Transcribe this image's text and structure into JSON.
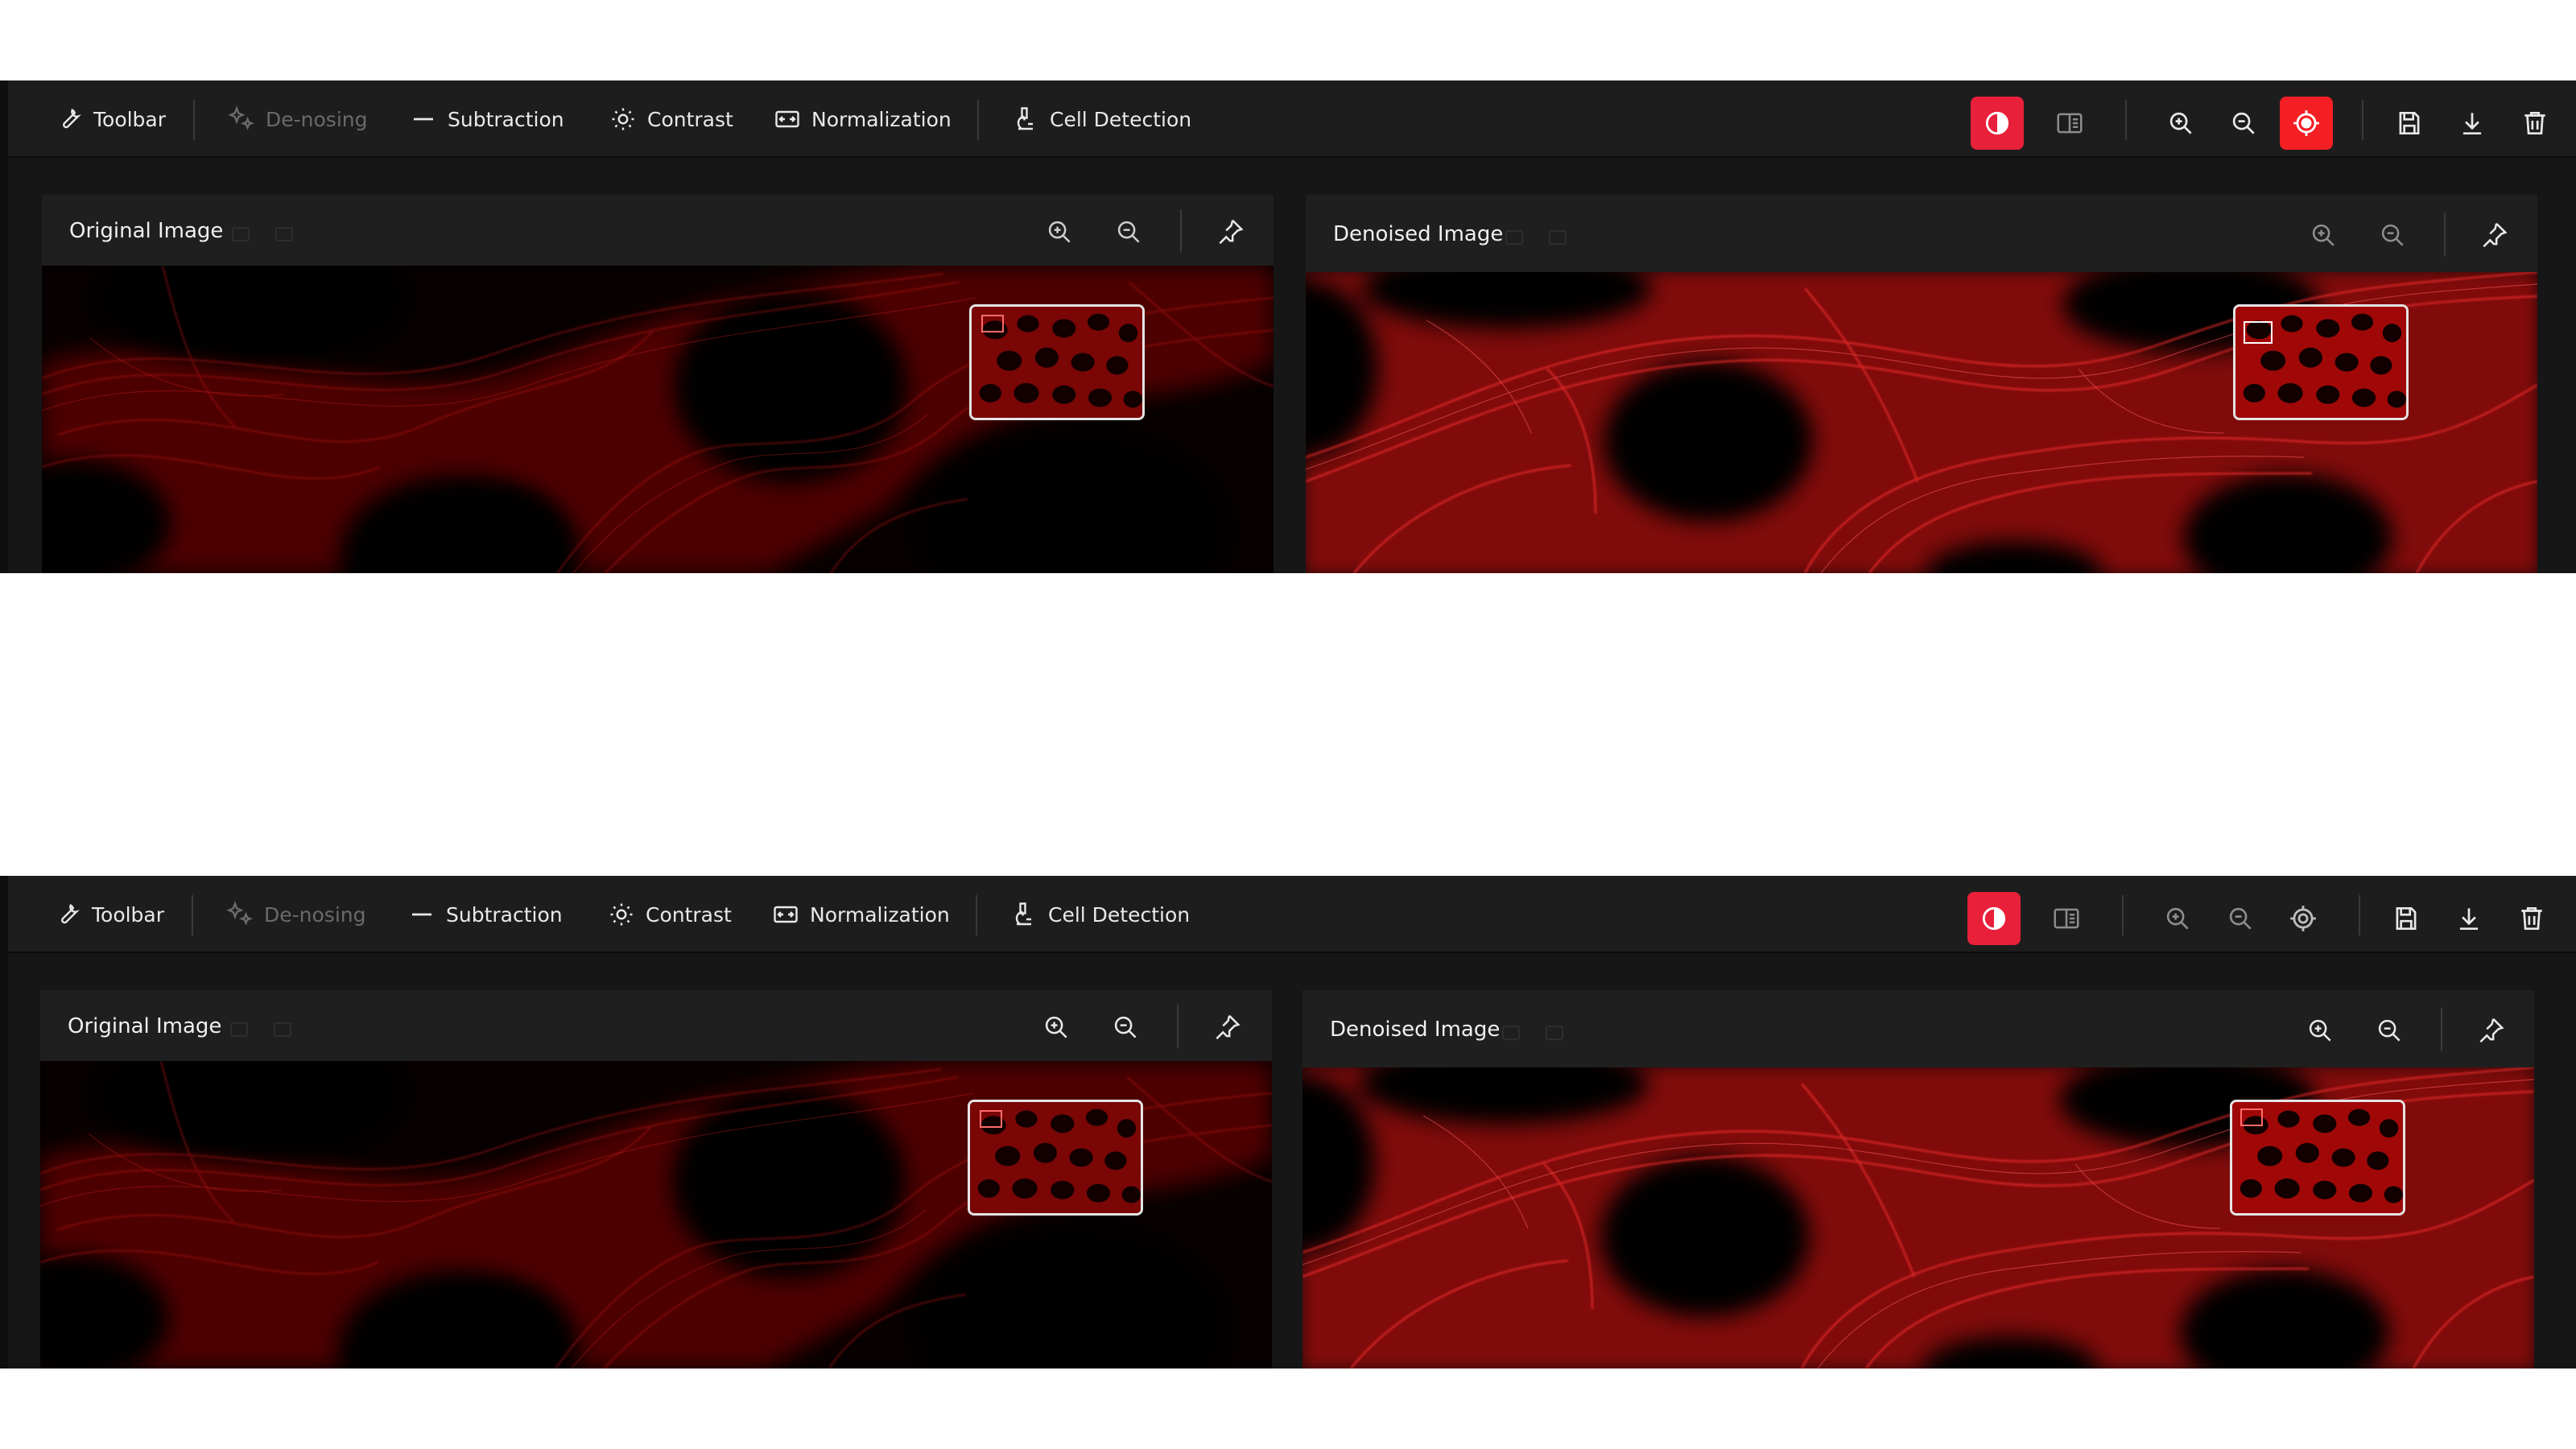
{
  "colors": {
    "accent": "#e8203a",
    "record_red": "#f41f24",
    "toolbar_bg": "#1d1d1d",
    "panel_bg": "#1f1f1f",
    "text": "#e9e9e9",
    "disabled_text": "#6a6a6a",
    "fluorescence": "#e01010"
  },
  "variants": [
    {
      "id": "a",
      "toolbar": {
        "items": [
          {
            "label": "Toolbar",
            "icon": "wrench-icon",
            "disabled": false
          },
          {
            "label": "De-nosing",
            "icon": "sparkle-icon",
            "disabled": true
          },
          {
            "label": "Subtraction",
            "icon": "minus-icon",
            "disabled": false
          },
          {
            "label": "Contrast",
            "icon": "sun-icon",
            "disabled": false
          },
          {
            "label": "Normalization",
            "icon": "normalize-icon",
            "disabled": false
          },
          {
            "label": "Cell Detection",
            "icon": "microscope-icon",
            "disabled": false
          }
        ],
        "right_icons": [
          "contrast-toggle-icon",
          "compare-split-icon",
          "zoom-in-icon",
          "zoom-out-icon",
          "focus-target-icon",
          "save-icon",
          "download-icon",
          "trash-icon"
        ],
        "focus_target_active": true
      },
      "panels": [
        {
          "title": "Original Image",
          "icons": [
            "zoom-in-icon",
            "zoom-out-icon",
            "pin-icon"
          ]
        },
        {
          "title": "Denoised Image",
          "icons": [
            "zoom-in-icon",
            "zoom-out-icon",
            "pin-icon"
          ]
        }
      ]
    },
    {
      "id": "b",
      "toolbar": {
        "items": [
          {
            "label": "Toolbar",
            "icon": "wrench-icon",
            "disabled": false
          },
          {
            "label": "De-nosing",
            "icon": "sparkle-icon",
            "disabled": true
          },
          {
            "label": "Subtraction",
            "icon": "minus-icon",
            "disabled": false
          },
          {
            "label": "Contrast",
            "icon": "sun-icon",
            "disabled": false
          },
          {
            "label": "Normalization",
            "icon": "normalize-icon",
            "disabled": false
          },
          {
            "label": "Cell Detection",
            "icon": "microscope-icon",
            "disabled": false
          }
        ],
        "right_icons": [
          "contrast-toggle-icon",
          "compare-split-icon",
          "zoom-in-icon",
          "zoom-out-icon",
          "focus-target-icon",
          "save-icon",
          "download-icon",
          "trash-icon"
        ],
        "focus_target_active": false
      },
      "panels": [
        {
          "title": "Original Image",
          "icons": [
            "zoom-in-icon",
            "zoom-out-icon",
            "pin-icon"
          ]
        },
        {
          "title": "Denoised Image",
          "icons": [
            "zoom-in-icon",
            "zoom-out-icon",
            "pin-icon"
          ]
        }
      ]
    }
  ]
}
